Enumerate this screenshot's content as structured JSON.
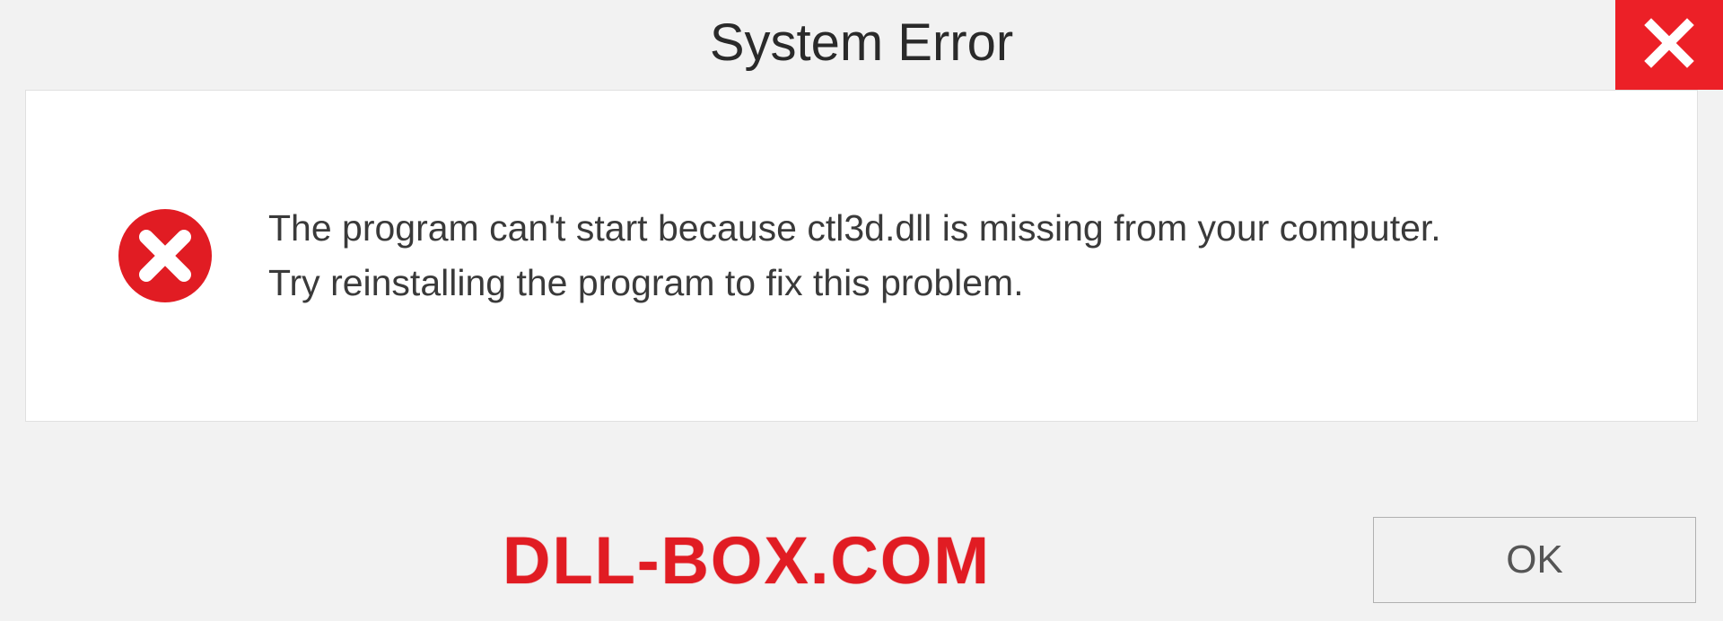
{
  "titlebar": {
    "title": "System Error"
  },
  "icons": {
    "close": "close-icon",
    "error": "error-circle-x-icon"
  },
  "message": {
    "line1": "The program can't start because ctl3d.dll is missing from your computer.",
    "line2": "Try reinstalling the program to fix this problem."
  },
  "footer": {
    "watermark": "DLL-BOX.COM",
    "ok_label": "OK"
  },
  "colors": {
    "close_bg": "#ec2027",
    "error_red": "#e11c23",
    "watermark_red": "#e11c23"
  }
}
